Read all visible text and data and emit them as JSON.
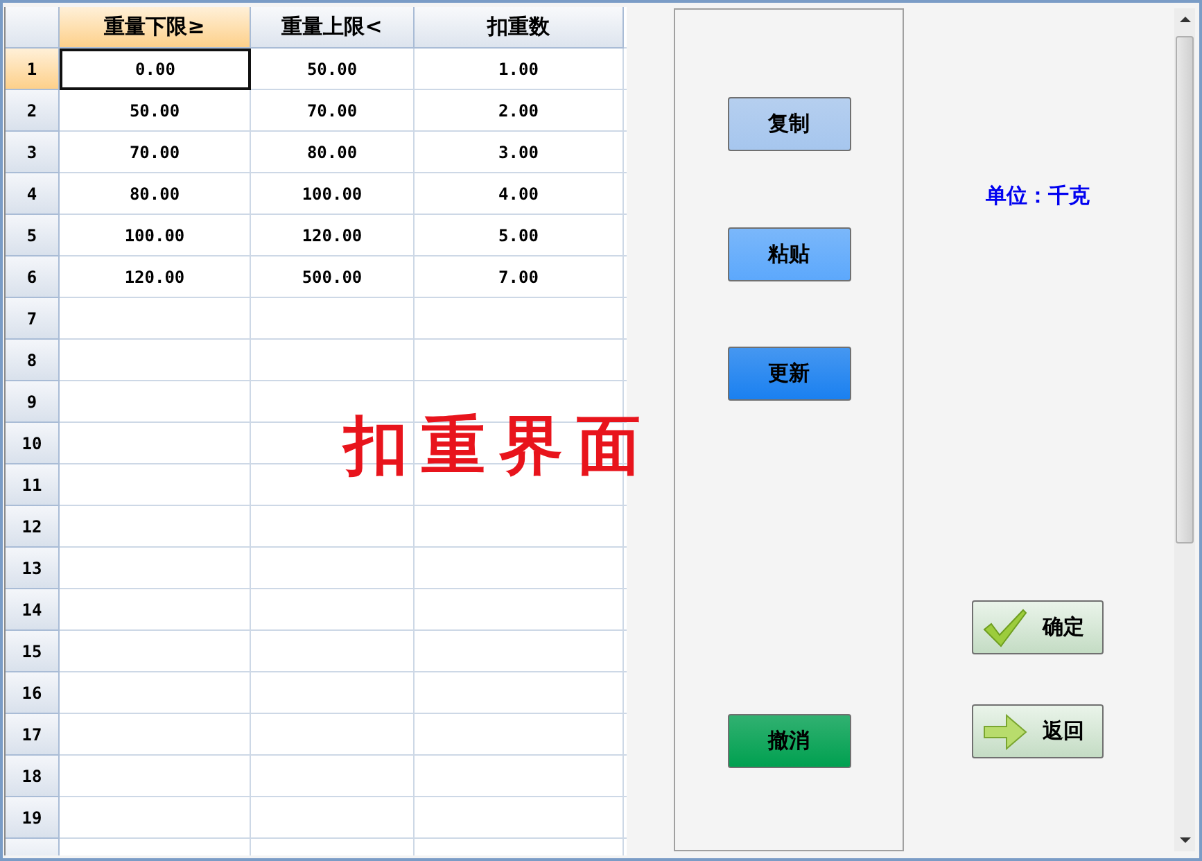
{
  "table": {
    "columns": [
      {
        "label": "重量下限≥",
        "selected": true
      },
      {
        "label": "重量上限<",
        "selected": false
      },
      {
        "label": "扣重数",
        "selected": false
      }
    ],
    "rows": [
      {
        "number": "1",
        "selected": true,
        "cells": [
          "0.00",
          "50.00",
          "1.00"
        ]
      },
      {
        "number": "2",
        "selected": false,
        "cells": [
          "50.00",
          "70.00",
          "2.00"
        ]
      },
      {
        "number": "3",
        "selected": false,
        "cells": [
          "70.00",
          "80.00",
          "3.00"
        ]
      },
      {
        "number": "4",
        "selected": false,
        "cells": [
          "80.00",
          "100.00",
          "4.00"
        ]
      },
      {
        "number": "5",
        "selected": false,
        "cells": [
          "100.00",
          "120.00",
          "5.00"
        ]
      },
      {
        "number": "6",
        "selected": false,
        "cells": [
          "120.00",
          "500.00",
          "7.00"
        ]
      },
      {
        "number": "7",
        "selected": false,
        "cells": [
          "",
          "",
          ""
        ]
      },
      {
        "number": "8",
        "selected": false,
        "cells": [
          "",
          "",
          ""
        ]
      },
      {
        "number": "9",
        "selected": false,
        "cells": [
          "",
          "",
          ""
        ]
      },
      {
        "number": "10",
        "selected": false,
        "cells": [
          "",
          "",
          ""
        ]
      },
      {
        "number": "11",
        "selected": false,
        "cells": [
          "",
          "",
          ""
        ]
      },
      {
        "number": "12",
        "selected": false,
        "cells": [
          "",
          "",
          ""
        ]
      },
      {
        "number": "13",
        "selected": false,
        "cells": [
          "",
          "",
          ""
        ]
      },
      {
        "number": "14",
        "selected": false,
        "cells": [
          "",
          "",
          ""
        ]
      },
      {
        "number": "15",
        "selected": false,
        "cells": [
          "",
          "",
          ""
        ]
      },
      {
        "number": "16",
        "selected": false,
        "cells": [
          "",
          "",
          ""
        ]
      },
      {
        "number": "17",
        "selected": false,
        "cells": [
          "",
          "",
          ""
        ]
      },
      {
        "number": "18",
        "selected": false,
        "cells": [
          "",
          "",
          ""
        ]
      },
      {
        "number": "19",
        "selected": false,
        "cells": [
          "",
          "",
          ""
        ]
      }
    ]
  },
  "overlay_title": "扣重界面",
  "edit_buttons": [
    {
      "label": "复制",
      "color": "#a6c6ee"
    },
    {
      "label": "粘贴",
      "color": "#5ca8fc"
    },
    {
      "label": "更新",
      "color": "#1a80f0"
    },
    {
      "label": "撤消",
      "color": "#00a050"
    }
  ],
  "unit_label": "单位：千克",
  "action_buttons": [
    {
      "label": "确定",
      "kind": "check"
    },
    {
      "label": "返回",
      "kind": "arrow"
    }
  ]
}
